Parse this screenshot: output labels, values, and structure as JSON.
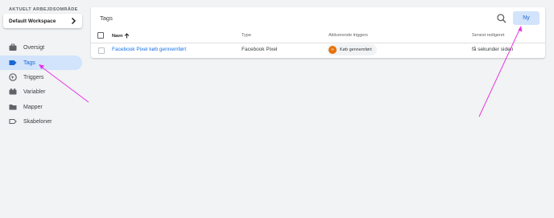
{
  "sidebar": {
    "workspace_caption": "AKTUELT ARBEJDSOMRÅDE",
    "workspace_name": "Default Workspace",
    "items": [
      {
        "label": "Oversigt",
        "icon": "briefcase-icon",
        "active": false
      },
      {
        "label": "Tags",
        "icon": "tag-icon",
        "active": true
      },
      {
        "label": "Triggers",
        "icon": "trigger-icon",
        "active": false
      },
      {
        "label": "Variabler",
        "icon": "variables-icon",
        "active": false
      },
      {
        "label": "Mapper",
        "icon": "folder-icon",
        "active": false
      },
      {
        "label": "Skabeloner",
        "icon": "template-icon",
        "active": false
      }
    ]
  },
  "main": {
    "title": "Tags",
    "new_button": "Ny",
    "columns": {
      "name": "Navn",
      "type": "Type",
      "triggers": "Aktiverende triggers",
      "edited": "Senest redigeret"
    },
    "rows": [
      {
        "name": "Facebook Pixel køb gennemført",
        "type": "Facebook Pixel",
        "trigger": "Køb gennemført",
        "edited": "få sekunder siden"
      }
    ]
  },
  "colors": {
    "accent": "#1a73e8",
    "active_bg": "#d2e3fc",
    "trigger_chip_icon": "#e8710a",
    "annotation_arrow": "#e934e0"
  }
}
